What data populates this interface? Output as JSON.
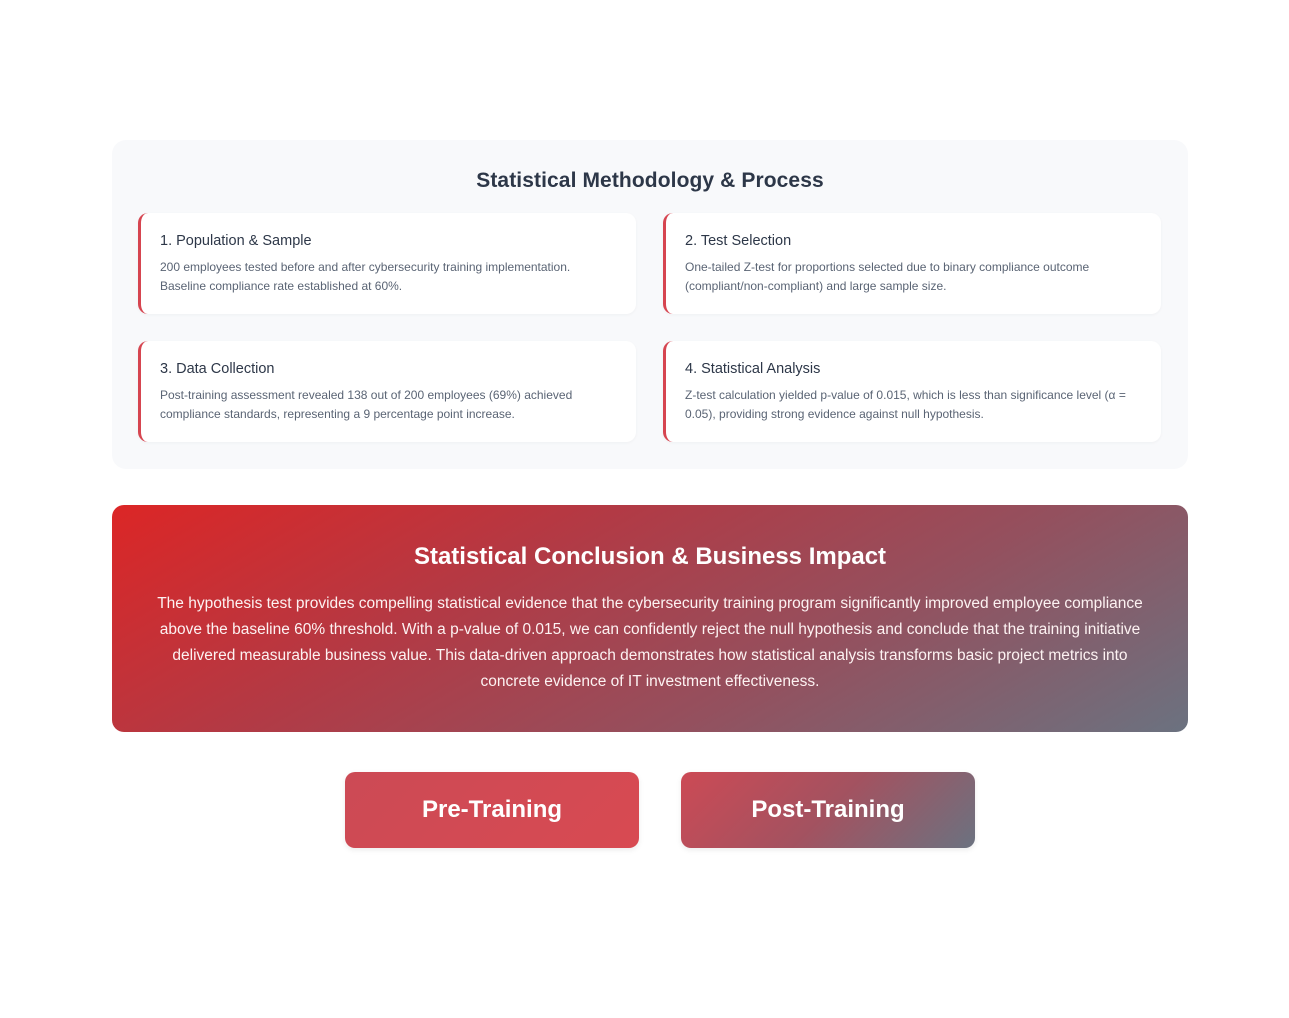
{
  "methodology": {
    "title": "Statistical Methodology & Process",
    "steps": [
      {
        "title": "1. Population & Sample",
        "body": "200 employees tested before and after cybersecurity training implementation. Baseline compliance rate established at 60%."
      },
      {
        "title": "2. Test Selection",
        "body": "One-tailed Z-test for proportions selected due to binary compliance outcome (compliant/non-compliant) and large sample size."
      },
      {
        "title": "3. Data Collection",
        "body": "Post-training assessment revealed 138 out of 200 employees (69%) achieved compliance standards, representing a 9 percentage point increase."
      },
      {
        "title": "4. Statistical Analysis",
        "body": "Z-test calculation yielded p-value of 0.015, which is less than significance level (α = 0.05), providing strong evidence against null hypothesis."
      }
    ]
  },
  "conclusion": {
    "title": "Statistical Conclusion & Business Impact",
    "body": "The hypothesis test provides compelling statistical evidence that the cybersecurity training program significantly improved employee compliance above the baseline 60% threshold. With a p-value of 0.015, we can confidently reject the null hypothesis and conclude that the training initiative delivered measurable business value. This data-driven approach demonstrates how statistical analysis transforms basic project metrics into concrete evidence of IT investment effectiveness."
  },
  "buttons": {
    "pre_label": "Pre-Training",
    "post_label": "Post-Training"
  },
  "colors": {
    "accent": "#d64550",
    "gradient_start": "#dc2626",
    "gradient_end": "#6b7280"
  }
}
